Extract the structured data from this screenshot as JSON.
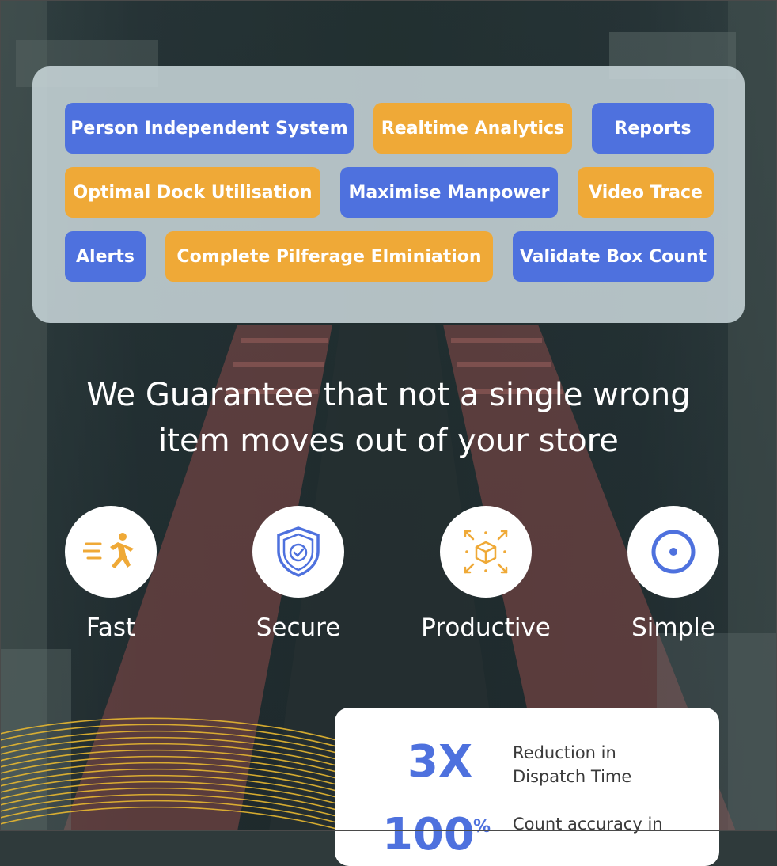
{
  "tags": [
    {
      "label": "Person Independent System",
      "color": "blue"
    },
    {
      "label": "Realtime Analytics",
      "color": "orange"
    },
    {
      "label": "Reports",
      "color": "blue"
    },
    {
      "label": "Optimal Dock Utilisation",
      "color": "orange"
    },
    {
      "label": "Maximise Manpower",
      "color": "blue"
    },
    {
      "label": "Video Trace",
      "color": "orange"
    },
    {
      "label": "Alerts",
      "color": "blue"
    },
    {
      "label": "Complete Pilferage Elminiation",
      "color": "orange"
    },
    {
      "label": "Validate Box Count",
      "color": "blue"
    }
  ],
  "headline": {
    "line1": "We Guarantee that not a single wrong",
    "line2": "item moves out of your store"
  },
  "features": [
    {
      "label": "Fast",
      "icon": "running-man-icon"
    },
    {
      "label": "Secure",
      "icon": "shield-check-icon"
    },
    {
      "label": "Productive",
      "icon": "box-expand-icon"
    },
    {
      "label": "Simple",
      "icon": "target-circle-icon"
    }
  ],
  "stats": [
    {
      "value": "3X",
      "description_line1": "Reduction in",
      "description_line2": "Dispatch Time"
    },
    {
      "value": "100",
      "unit": "%",
      "description_line1": "Count accuracy in",
      "description_line2": ""
    }
  ],
  "colors": {
    "brand_blue": "#4e71de",
    "brand_orange": "#efa937",
    "panel": "#c7d5d8",
    "text_light": "#ffffff"
  }
}
